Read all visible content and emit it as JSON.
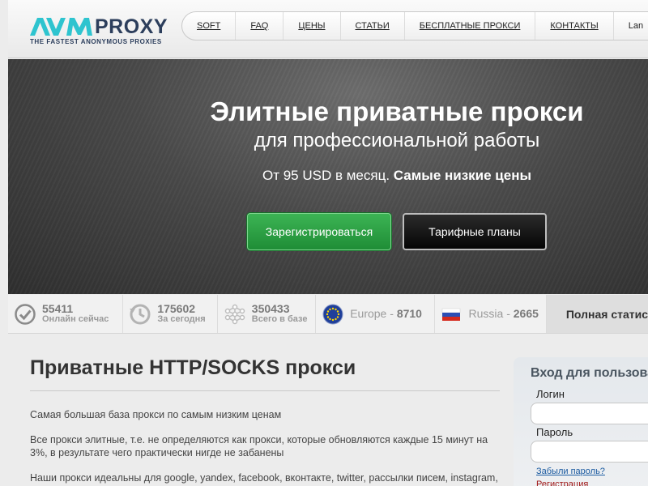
{
  "logo": {
    "brand": "PROXY",
    "tagline": "THE FASTEST ANONYMOUS PROXIES"
  },
  "nav": {
    "items": [
      "SOFT",
      "FAQ",
      "ЦЕНЫ",
      "СТАТЬИ",
      "БЕСПЛАТНЫЕ ПРОКСИ",
      "КОНТАКТЫ"
    ],
    "language": "Lan"
  },
  "hero": {
    "title": "Элитные приватные прокси",
    "subtitle": "для профессиональной работы",
    "price_text": "От 95 USD в месяц.",
    "price_highlight": "Самые низкие цены",
    "register_button": "Зарегистрироваться",
    "plans_button": "Тарифные планы"
  },
  "stats": {
    "online": {
      "value": "55411",
      "label": "Онлайн сейчас",
      "icon": "check-circle-icon"
    },
    "today": {
      "value": "175602",
      "label": "За сегодня",
      "icon": "clock-icon"
    },
    "total": {
      "value": "350433",
      "label": "Всего в базе",
      "icon": "network-icon"
    },
    "europe": {
      "name": "Europe",
      "sep": " - ",
      "value": "8710",
      "icon": "eu-flag-icon"
    },
    "russia": {
      "name": "Russia",
      "sep": " - ",
      "value": "2665",
      "icon": "ru-flag-icon"
    },
    "full_stats": "Полная статис"
  },
  "main": {
    "title": "Приватные HTTP/SOCKS прокси",
    "p1": "Самая большая база прокси по самым низким ценам",
    "p2": "Все прокси элитные, т.е. не определяются как прокси, которые обновляются каждые 15 минут на 3%, в результате чего практически нигде не забанены",
    "p3": "Наши прокси идеальны для google, yandex, facebook, вконтакте, twitter, рассылки писем, instagram,"
  },
  "login": {
    "title": "Вход для пользова",
    "login_label": "Логин",
    "password_label": "Пароль",
    "forgot_link": "Забыли пароль?",
    "register_link": "Регистрация"
  },
  "colors": {
    "brand": "#2c3e5c",
    "logo_accent": "#2ec4cf",
    "register_green": "#2aa043",
    "forgot_link": "#1a5aa0",
    "register_link": "#a01818"
  }
}
